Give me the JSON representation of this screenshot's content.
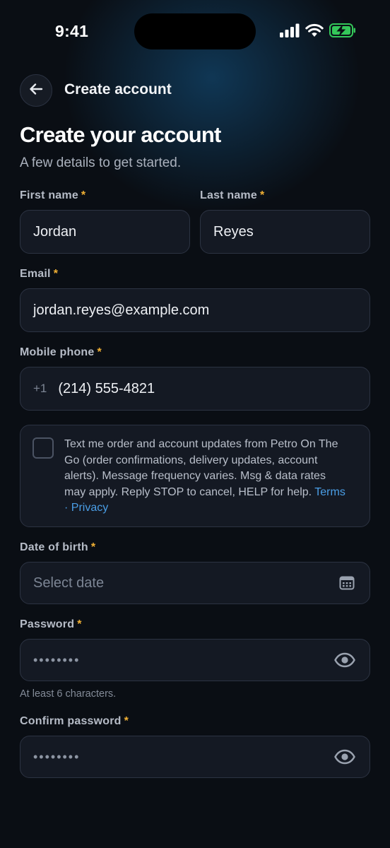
{
  "status_bar": {
    "time": "9:41"
  },
  "header": {
    "title": "Create account"
  },
  "page": {
    "title": "Create your account",
    "subtitle": "A few details to get started."
  },
  "form": {
    "required_marker": "*",
    "first_name": {
      "label": "First name",
      "value": "Jordan"
    },
    "last_name": {
      "label": "Last name",
      "value": "Reyes"
    },
    "email": {
      "label": "Email",
      "value": "jordan.reyes@example.com"
    },
    "phone": {
      "label": "Mobile phone",
      "country_code": "+1",
      "value": "(214) 555-4821"
    },
    "sms_consent": {
      "checked": false,
      "text": "Text me order and account updates from Petro On The Go (order confirmations, delivery updates, account alerts). Message frequency varies. Msg & data rates may apply. Reply STOP to cancel, HELP for help.",
      "terms_link": "Terms",
      "separator": "·",
      "privacy_link": "Privacy"
    },
    "dob": {
      "label": "Date of birth",
      "placeholder": "Select date"
    },
    "password": {
      "label": "Password",
      "masked_value": "••••••••",
      "hint": "At least 6 characters."
    },
    "confirm_password": {
      "label": "Confirm password",
      "masked_value": "••••••••"
    }
  },
  "colors": {
    "accent_required": "#f2b134",
    "link": "#4a9ee6",
    "battery": "#34c759",
    "background": "#0a0e14"
  },
  "icons": [
    "cellular-signal-icon",
    "wifi-icon",
    "battery-charging-icon",
    "back-arrow-icon",
    "calendar-icon",
    "eye-icon"
  ]
}
